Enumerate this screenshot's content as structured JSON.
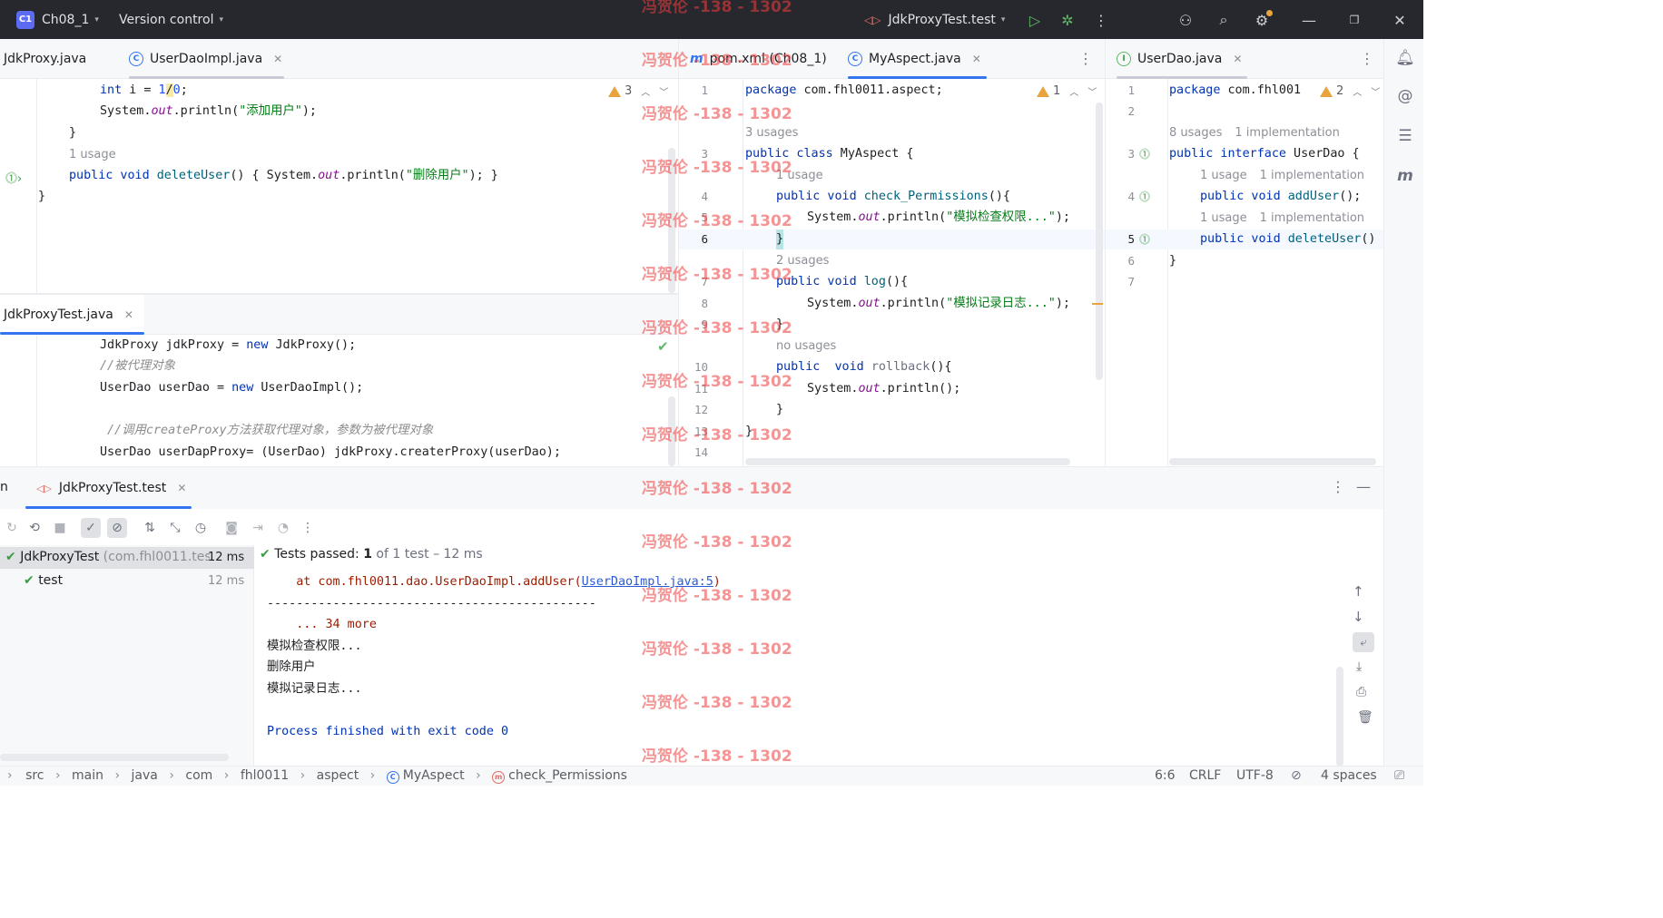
{
  "titlebar": {
    "project_badge": "C1",
    "project": "Ch08_1",
    "vcs": "Version control",
    "run_config": "JdkProxyTest.test"
  },
  "left_top": {
    "tabs": [
      {
        "label": "JdkProxy.java"
      },
      {
        "label": "UserDaoImpl.java"
      }
    ],
    "warning_count": "3",
    "lines": {
      "l1_kw": "int",
      "l1_rest": " i = ",
      "l1_num1": "1",
      "l1_op": "/",
      "l1_num2": "0",
      "l1_end": ";",
      "l2_a": "System.",
      "l2_out": "out",
      "l2_b": ".println(",
      "l2_str": "\"添加用户\"",
      "l2_c": ");",
      "l3": "}",
      "usage": "1 usage",
      "l4_kw": "public void ",
      "l4_fn": "deleteUser",
      "l4_a": "() { System.",
      "l4_out": "out",
      "l4_b": ".println(",
      "l4_str": "\"删除用户\"",
      "l4_c": "); }",
      "l5": "}"
    }
  },
  "left_bottom": {
    "tab": "JdkProxyTest.java",
    "lines": {
      "l1_a": "JdkProxy jdkProxy = ",
      "l1_kw": "new",
      "l1_b": " JdkProxy();",
      "l2": "//被代理对象",
      "l3_a": "UserDao userDao = ",
      "l3_kw": "new",
      "l3_b": " UserDaoImpl();",
      "l4": "//调用createProxy方法获取代理对象，参数为被代理对象",
      "l5": "UserDao userDapProxy= (UserDao) jdkProxy.createrProxy(userDao);"
    }
  },
  "middle": {
    "tabs": [
      {
        "label": "pom.xml (Ch08_1)"
      },
      {
        "label": "MyAspect.java"
      }
    ],
    "warning_count": "1",
    "line_numbers": [
      "1",
      "3",
      "4",
      "5",
      "6",
      "7",
      "8",
      "9",
      "10",
      "11",
      "12",
      "13",
      "14"
    ],
    "code": {
      "package_kw": "package",
      "package_name": " com.fhl0011.aspect;",
      "usage_3": "3 usages",
      "class_kw": "public class",
      "class_name": " MyAspect {",
      "usage_1": "1 usage",
      "m1_kw": "public void ",
      "m1_fn": "check_Permissions",
      "m1_end": "(){",
      "m1_body_a": "System.",
      "m1_body_out": "out",
      "m1_body_b": ".println(",
      "m1_body_str": "\"模拟检查权限...\"",
      "m1_body_c": ");",
      "close1": "}",
      "usage_2": "2 usages",
      "m2_kw": "public void ",
      "m2_fn": "log",
      "m2_end": "(){",
      "m2_body_a": "System.",
      "m2_body_out": "out",
      "m2_body_b": ".println(",
      "m2_body_str": "\"模拟记录日志...\"",
      "m2_body_c": ");",
      "close2": "}",
      "usage_none": "no usages",
      "m3_kw": "public  void ",
      "m3_fn": "rollback",
      "m3_end": "(){",
      "m3_body_a": "System.",
      "m3_body_out": "out",
      "m3_body_b": ".println();",
      "close3": "}",
      "close_class": "}"
    }
  },
  "right": {
    "tab": "UserDao.java",
    "warning_count": "2",
    "line_numbers": [
      "1",
      "2",
      "3",
      "4",
      "5",
      "6",
      "7"
    ],
    "code": {
      "package_kw": "package",
      "package_name": " com.fhl001",
      "usage_a": "8 usages",
      "impl_a": "1 implementation",
      "iface_kw": "public interface",
      "iface_name": " UserDao {",
      "usage_b": "1 usage",
      "impl_b": "1 implementation",
      "m1_kw": "public void ",
      "m1_fn": "addUser",
      "m1_end": "();",
      "usage_c": "1 usage",
      "impl_c": "1 implementation",
      "m2_kw": "public void ",
      "m2_fn": "deleteUser",
      "m2_end": "()",
      "close": "}"
    }
  },
  "run": {
    "partial_label": "n",
    "tab": "JdkProxyTest.test",
    "tree": [
      {
        "name": "JdkProxyTest",
        "detail": " (com.fhl0011.tes",
        "time": "12 ms"
      },
      {
        "name": "test",
        "detail": "",
        "time": "12 ms"
      }
    ],
    "status_prefix": "Tests passed: ",
    "status_count": "1",
    "status_rest": " of 1 test – 12 ms",
    "output": {
      "at_prefix": "    at com.fhl0011.dao.UserDaoImpl.addUser(",
      "at_link": "UserDaoImpl.java:5",
      "at_suffix": ")",
      "dashes": "---------------------------------------------",
      "more": "    ... 34 more",
      "o1": "模拟检查权限...",
      "o2": "删除用户",
      "o3": "模拟记录日志...",
      "finish": "Process finished with exit code 0"
    }
  },
  "breadcrumbs": [
    "src",
    "main",
    "java",
    "com",
    "fhl0011",
    "aspect",
    "MyAspect",
    "check_Permissions"
  ],
  "status": {
    "position": "6:6",
    "line_sep": "CRLF",
    "encoding": "UTF-8",
    "indent": "4 spaces"
  },
  "watermark": "冯贺伦 -138 - 1302"
}
